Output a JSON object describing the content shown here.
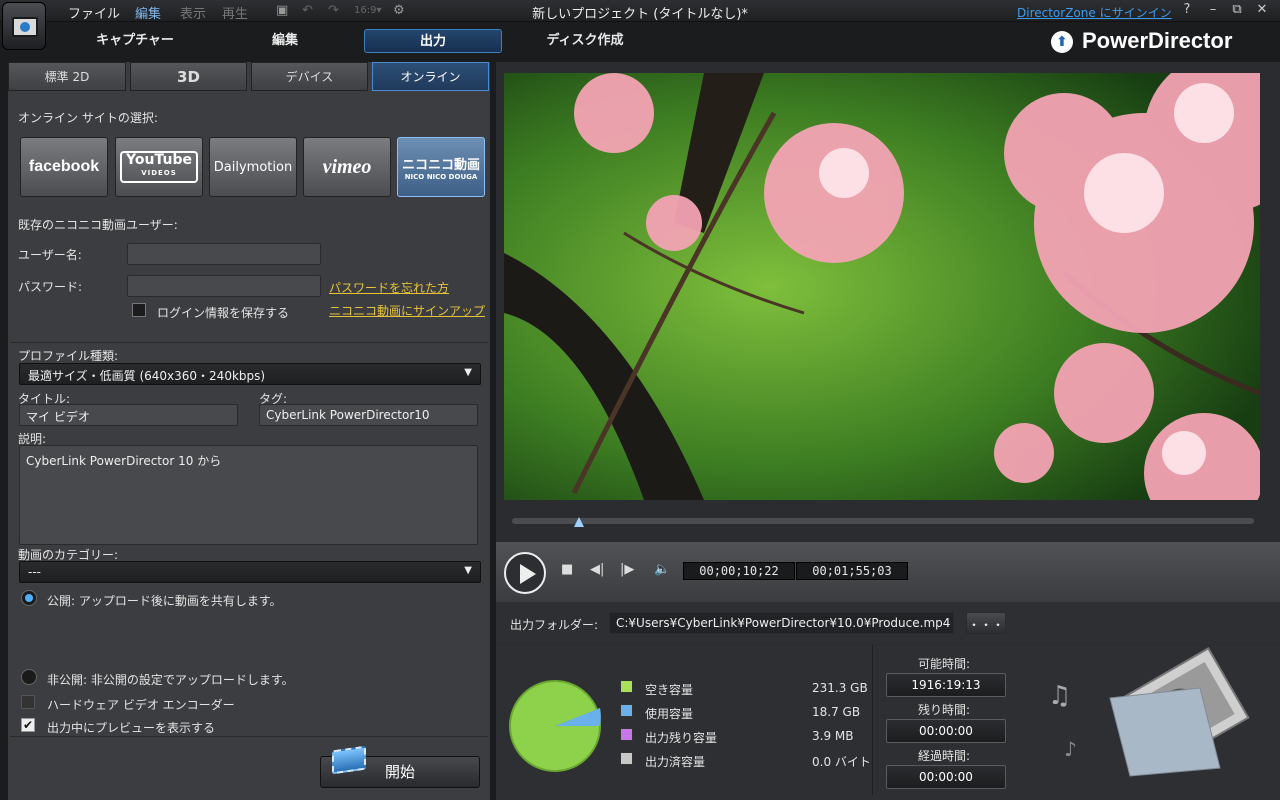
{
  "menu": {
    "file": "ファイル",
    "edit": "編集",
    "view": "表示",
    "play": "再生"
  },
  "window_title": "新しいプロジェクト (タイトルなし)*",
  "directorzone": "DirectorZone にサインイン",
  "window_buttons": {
    "help": "?",
    "minimize": "–",
    "restore": "⧉",
    "close": "✕"
  },
  "modes": {
    "capture": "キャプチャー",
    "edit": "編集",
    "produce": "出力",
    "disc": "ディスク作成"
  },
  "brand": "PowerDirector",
  "tabs": {
    "std2d": "標準 2D",
    "three_d": "3D",
    "device": "デバイス",
    "online": "オンライン"
  },
  "online": {
    "site_label": "オンライン サイトの選択:",
    "sites": [
      "facebook",
      "YouTube",
      "Dailymotion",
      "vimeo",
      "ニコニコ動画"
    ],
    "youtube_sub": "VIDEOS",
    "niconico_sub": "NICO NICO DOUGA",
    "existing_user": "既存のニコニコ動画ユーザー:",
    "username_label": "ユーザー名:",
    "username_value": "",
    "password_label": "パスワード:",
    "password_value": "",
    "forgot_link": "パスワードを忘れた方",
    "signup_link": "ニコニコ動画にサインアップ",
    "save_login": "ログイン情報を保存する",
    "profile_label": "プロファイル種類:",
    "profile_value": "最適サイズ・低画質 (640x360・240kbps)",
    "title_label": "タイトル:",
    "title_value": "マイ ビデオ",
    "tag_label": "タグ:",
    "tag_value": "CyberLink PowerDirector10",
    "desc_label": "説明:",
    "desc_value": "CyberLink PowerDirector 10 から",
    "category_label": "動画のカテゴリー:",
    "category_value": "---",
    "public_label": "公開: アップロード後に動画を共有します。",
    "private_label": "非公開: 非公開の設定でアップロードします。",
    "hw_encoder": "ハードウェア ビデオ エンコーダー",
    "show_preview": "出力中にプレビューを表示する",
    "start": "開始"
  },
  "player": {
    "timecode_current": "00;00;10;22",
    "timecode_total": "00;01;55;03",
    "seek_fraction": 0.09
  },
  "output": {
    "folder_label": "出力フォルダー:",
    "folder_value": "C:¥Users¥CyberLink¥PowerDirector¥10.0¥Produce.mp4",
    "browse": "・・・"
  },
  "disk": {
    "free_label": "空き容量",
    "free_value": "231.3  GB",
    "free_color": "#a8e05a",
    "used_label": "使用容量",
    "used_value": "18.7  GB",
    "used_color": "#6ab0ea",
    "remaining_label": "出力残り容量",
    "remaining_value": "3.9  MB",
    "remaining_color": "#c778e8",
    "done_label": "出力済容量",
    "done_value": "0.0  バイト",
    "done_color": "#c8c8c8"
  },
  "times": {
    "available_label": "可能時間:",
    "available_value": "1916:19:13",
    "remaining_label": "残り時間:",
    "remaining_value": "00:00:00",
    "elapsed_label": "経過時間:",
    "elapsed_value": "00:00:00"
  }
}
